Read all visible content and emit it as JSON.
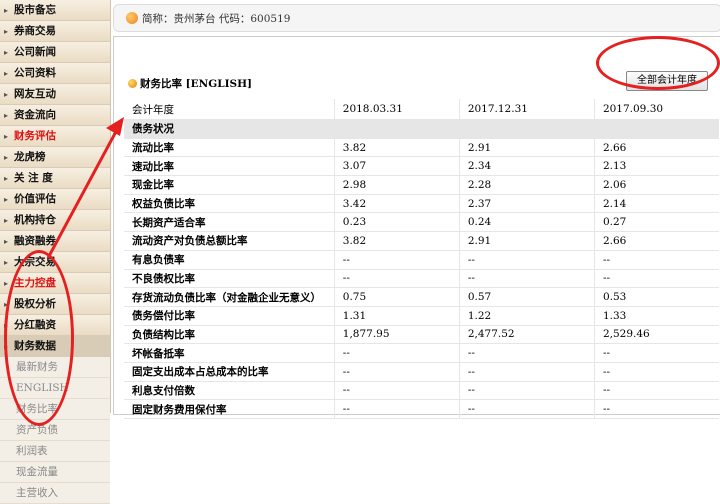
{
  "sidebar": {
    "items": [
      {
        "label": "股市备忘",
        "red": false
      },
      {
        "label": "券商交易",
        "red": false
      },
      {
        "label": "公司新闻",
        "red": false
      },
      {
        "label": "公司资料",
        "red": false
      },
      {
        "label": "网友互动",
        "red": false
      },
      {
        "label": "资金流向",
        "red": false
      },
      {
        "label": "财务评估",
        "red": true
      },
      {
        "label": "龙虎榜",
        "red": false
      },
      {
        "label": "关 注 度",
        "red": false
      },
      {
        "label": "价值评估",
        "red": false
      },
      {
        "label": "机构持仓",
        "red": false
      },
      {
        "label": "融资融券",
        "red": false
      },
      {
        "label": "大宗交易",
        "red": false
      },
      {
        "label": "主力控盘",
        "red": true
      },
      {
        "label": "股权分析",
        "red": false
      },
      {
        "label": "分红融资",
        "red": false
      }
    ],
    "group_label": "财务数据",
    "sub_items": [
      "最新财务",
      "ENGLISH",
      "财务比率",
      "资产负债",
      "利润表",
      "现金流量",
      "主营收入"
    ]
  },
  "header": {
    "short_name_label": "简称：",
    "short_name": "贵州茅台",
    "code_label": "代码：",
    "code": "600519"
  },
  "panel": {
    "title": "财务比率 [ENGLISH]",
    "all_years_button": "全部会计年度"
  },
  "table": {
    "header_label": "会计年度",
    "periods": [
      "2018.03.31",
      "2017.12.31",
      "2017.09.30"
    ],
    "section": "债务状况",
    "rows": [
      {
        "label": "流动比率",
        "values": [
          "3.82",
          "2.91",
          "2.66"
        ]
      },
      {
        "label": "速动比率",
        "values": [
          "3.07",
          "2.34",
          "2.13"
        ]
      },
      {
        "label": "现金比率",
        "values": [
          "2.98",
          "2.28",
          "2.06"
        ]
      },
      {
        "label": "权益负债比率",
        "values": [
          "3.42",
          "2.37",
          "2.14"
        ]
      },
      {
        "label": "长期资产适合率",
        "values": [
          "0.23",
          "0.24",
          "0.27"
        ]
      },
      {
        "label": "流动资产对负债总额比率",
        "values": [
          "3.82",
          "2.91",
          "2.66"
        ]
      },
      {
        "label": "有息负债率",
        "values": [
          "--",
          "--",
          "--"
        ]
      },
      {
        "label": "不良债权比率",
        "values": [
          "--",
          "--",
          "--"
        ]
      },
      {
        "label": "存货流动负债比率（对金融企业无意义）",
        "values": [
          "0.75",
          "0.57",
          "0.53"
        ]
      },
      {
        "label": "债务偿付比率",
        "values": [
          "1.31",
          "1.22",
          "1.33"
        ]
      },
      {
        "label": "负债结构比率",
        "values": [
          "1,877.95",
          "2,477.52",
          "2,529.46"
        ]
      },
      {
        "label": "坏帐备抵率",
        "values": [
          "--",
          "--",
          "--"
        ]
      },
      {
        "label": "固定支出成本占总成本的比率",
        "values": [
          "--",
          "--",
          "--"
        ]
      },
      {
        "label": "利息支付倍数",
        "values": [
          "--",
          "--",
          "--"
        ]
      },
      {
        "label": "固定财务费用保付率",
        "values": [
          "--",
          "--",
          "--"
        ]
      }
    ]
  },
  "colors": {
    "annotation": "#e42020",
    "sidebar_bg": "#efe6d8",
    "nav_red": "#dd1111",
    "section_bg": "#e6e6e6"
  }
}
